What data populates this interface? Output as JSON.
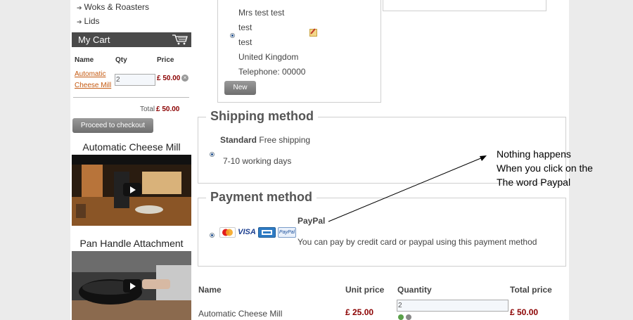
{
  "sidebar": {
    "categories": [
      {
        "label": "Woks & Roasters"
      },
      {
        "label": "Lids"
      }
    ],
    "cart": {
      "title": "My Cart",
      "col_name": "Name",
      "col_qty": "Qty",
      "col_price": "Price",
      "item_name_line1": "Automatic",
      "item_name_line2": "Cheese Mill",
      "item_qty": "2",
      "item_price": "£ 50.00",
      "total_label": "Total",
      "total_value": "£ 50.00",
      "checkout_label": "Proceed to checkout"
    },
    "videos": [
      {
        "title": "Automatic Cheese Mill"
      },
      {
        "title": "Pan Handle Attachment"
      }
    ]
  },
  "address": {
    "name": "Mrs test test",
    "line1": "test",
    "line2": "test",
    "country": "United Kingdom",
    "phone": "Telephone: 00000",
    "new_label": "New"
  },
  "shipping": {
    "legend": "Shipping method",
    "option_name": "Standard",
    "option_desc": "Free shipping",
    "option_time": "7-10 working days"
  },
  "payment": {
    "legend": "Payment method",
    "option_name": "PayPal",
    "option_desc": "You can pay by credit card or paypal using this payment method",
    "cards": [
      "MC",
      "VISA",
      "AMEX",
      "PayPal"
    ]
  },
  "annotation": {
    "line1": "Nothing happens",
    "line2": "When you click on the",
    "line3": "The word Paypal"
  },
  "order_table": {
    "headers": {
      "name": "Name",
      "unit_price": "Unit price",
      "quantity": "Quantity",
      "total_price": "Total price"
    },
    "rows": [
      {
        "name": "Automatic Cheese Mill",
        "unit_price": "£ 25.00",
        "quantity": "2",
        "total_price": "£ 50.00"
      }
    ]
  },
  "colors": {
    "accent_red": "#8b0000",
    "link_orange": "#c55a11",
    "cart_header": "#4a4a4a"
  }
}
